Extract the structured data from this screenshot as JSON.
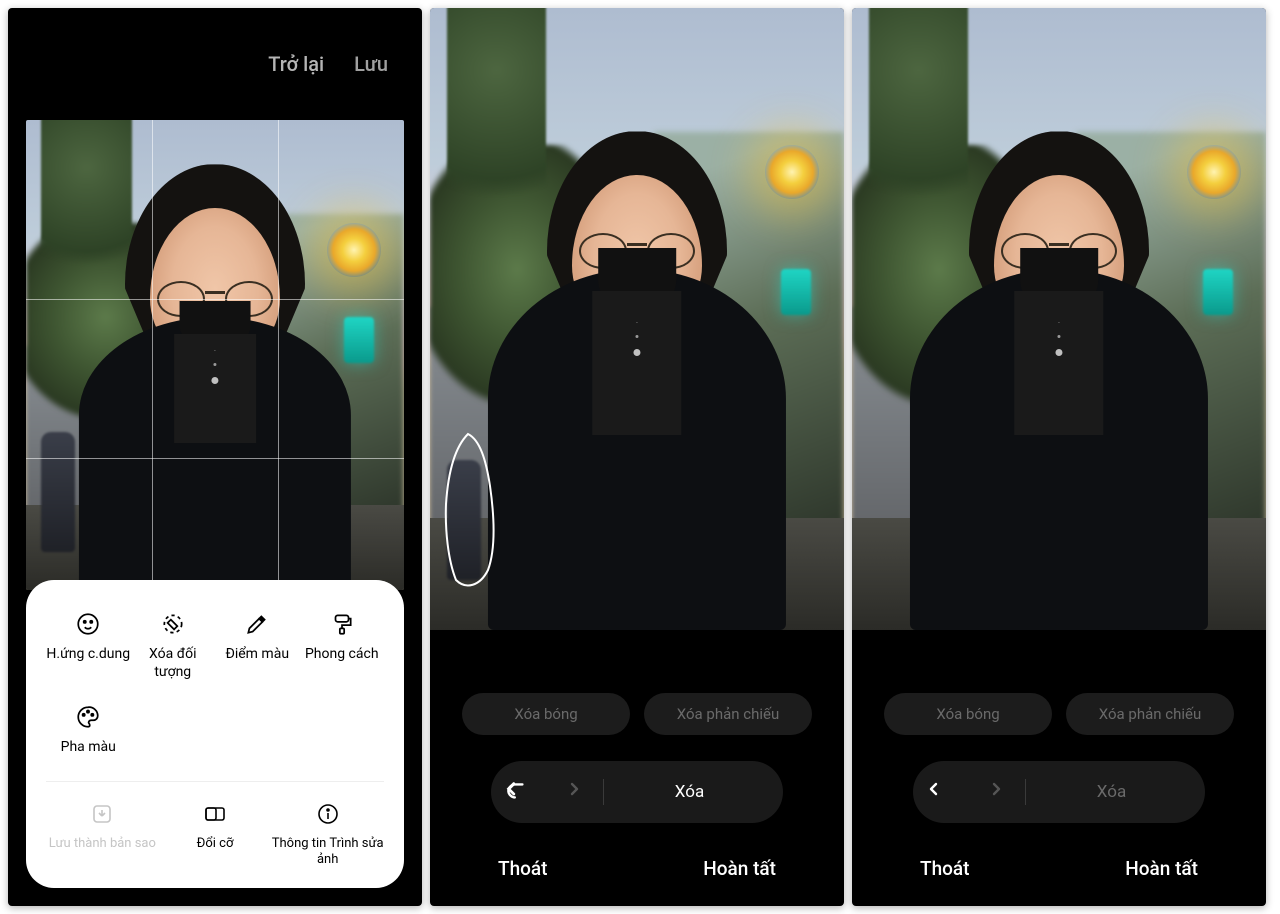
{
  "panel1": {
    "back": "Trở lại",
    "save": "Lưu",
    "tools": [
      {
        "label": "H.ứng c.dung",
        "icon": "face"
      },
      {
        "label": "Xóa đối tượng",
        "icon": "erase"
      },
      {
        "label": "Điểm màu",
        "icon": "dropper"
      },
      {
        "label": "Phong cách",
        "icon": "brush"
      },
      {
        "label": "Pha màu",
        "icon": "palette"
      }
    ],
    "bottom": [
      {
        "label": "Lưu thành bản sao",
        "icon": "savecopy",
        "disabled": true
      },
      {
        "label": "Đổi cỡ",
        "icon": "resize"
      },
      {
        "label": "Thông tin Trình sửa ảnh",
        "icon": "info"
      }
    ]
  },
  "eraser": {
    "remove_shadow": "Xóa bóng",
    "remove_reflection": "Xóa phản chiếu",
    "undo": "undo",
    "redo": "redo",
    "delete": "Xóa",
    "exit": "Thoát",
    "done": "Hoàn tất"
  },
  "panel2": {
    "delete_enabled": true,
    "undo_enabled": true,
    "show_pedestrian": true,
    "show_lasso": true
  },
  "panel3": {
    "delete_enabled": false,
    "undo_enabled": true,
    "show_pedestrian": false,
    "show_lasso": false
  }
}
